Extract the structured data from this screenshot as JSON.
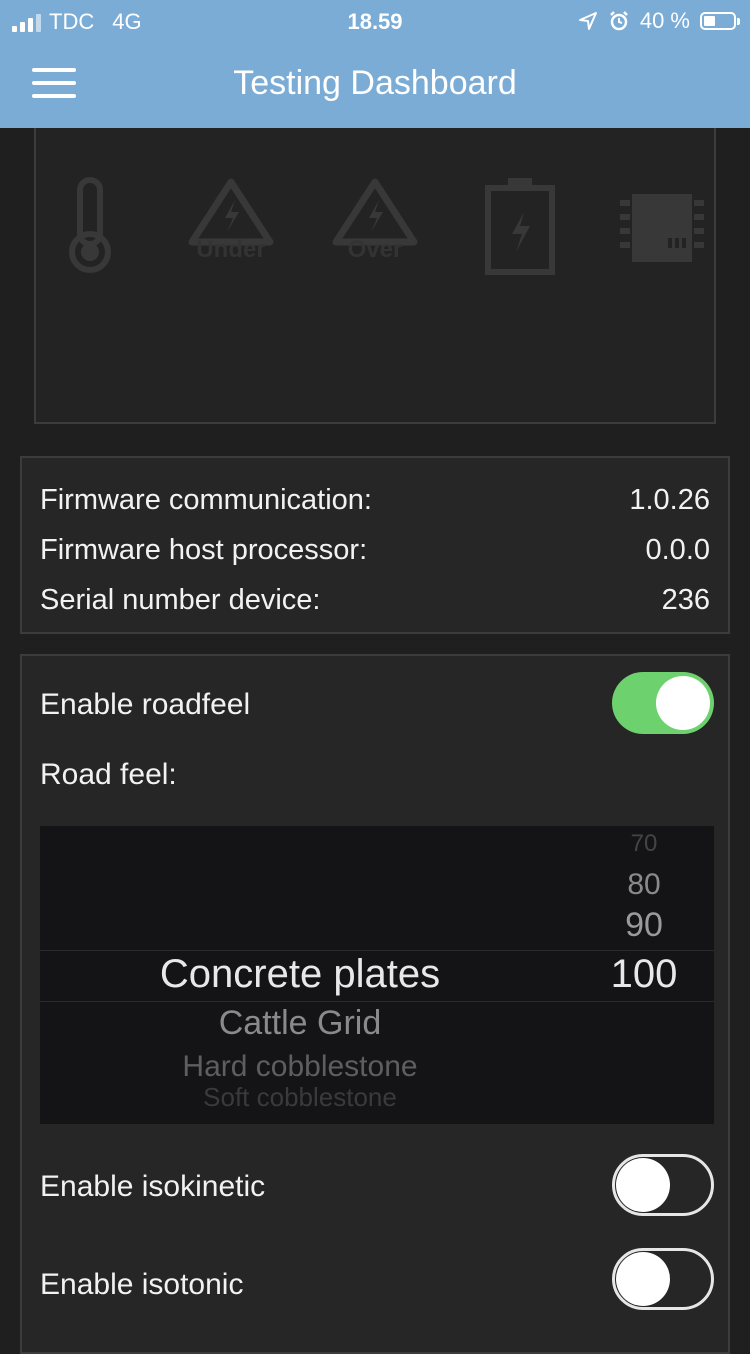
{
  "status_bar": {
    "carrier": "TDC",
    "network": "4G",
    "time": "18.59",
    "battery_text": "40 %",
    "battery_level": 0.4
  },
  "nav": {
    "title": "Testing Dashboard",
    "menu_icon": "hamburger-menu-icon"
  },
  "alarms": {
    "items": [
      {
        "icon": "thermometer-icon",
        "label": ""
      },
      {
        "icon": "warning-triangle-icon",
        "label": "Under"
      },
      {
        "icon": "warning-triangle-icon",
        "label": "Over"
      },
      {
        "icon": "battery-icon",
        "label": ""
      },
      {
        "icon": "chip-icon",
        "label": ""
      }
    ]
  },
  "firmware": {
    "rows": [
      {
        "label": "Firmware communication:",
        "value": "1.0.26"
      },
      {
        "label": "Firmware host processor:",
        "value": "0.0.0"
      },
      {
        "label": "Serial number device:",
        "value": "236"
      }
    ]
  },
  "settings": {
    "enable_roadfeel": {
      "label": "Enable roadfeel",
      "on": true
    },
    "road_feel_label": "Road feel:",
    "road_types": [
      "Concrete plates",
      "Cattle Grid",
      "Hard cobblestone",
      "Soft cobblestone"
    ],
    "intensity_values": [
      "70",
      "80",
      "90",
      "100"
    ],
    "selected_road": "Concrete plates",
    "selected_intensity": "100",
    "enable_isokinetic": {
      "label": "Enable isokinetic",
      "on": false
    },
    "enable_isotonic": {
      "label": "Enable isotonic",
      "on": false
    }
  },
  "colors": {
    "header": "#7aacd6",
    "background": "#1f1f1f",
    "toggle_on": "#6dd26d"
  }
}
